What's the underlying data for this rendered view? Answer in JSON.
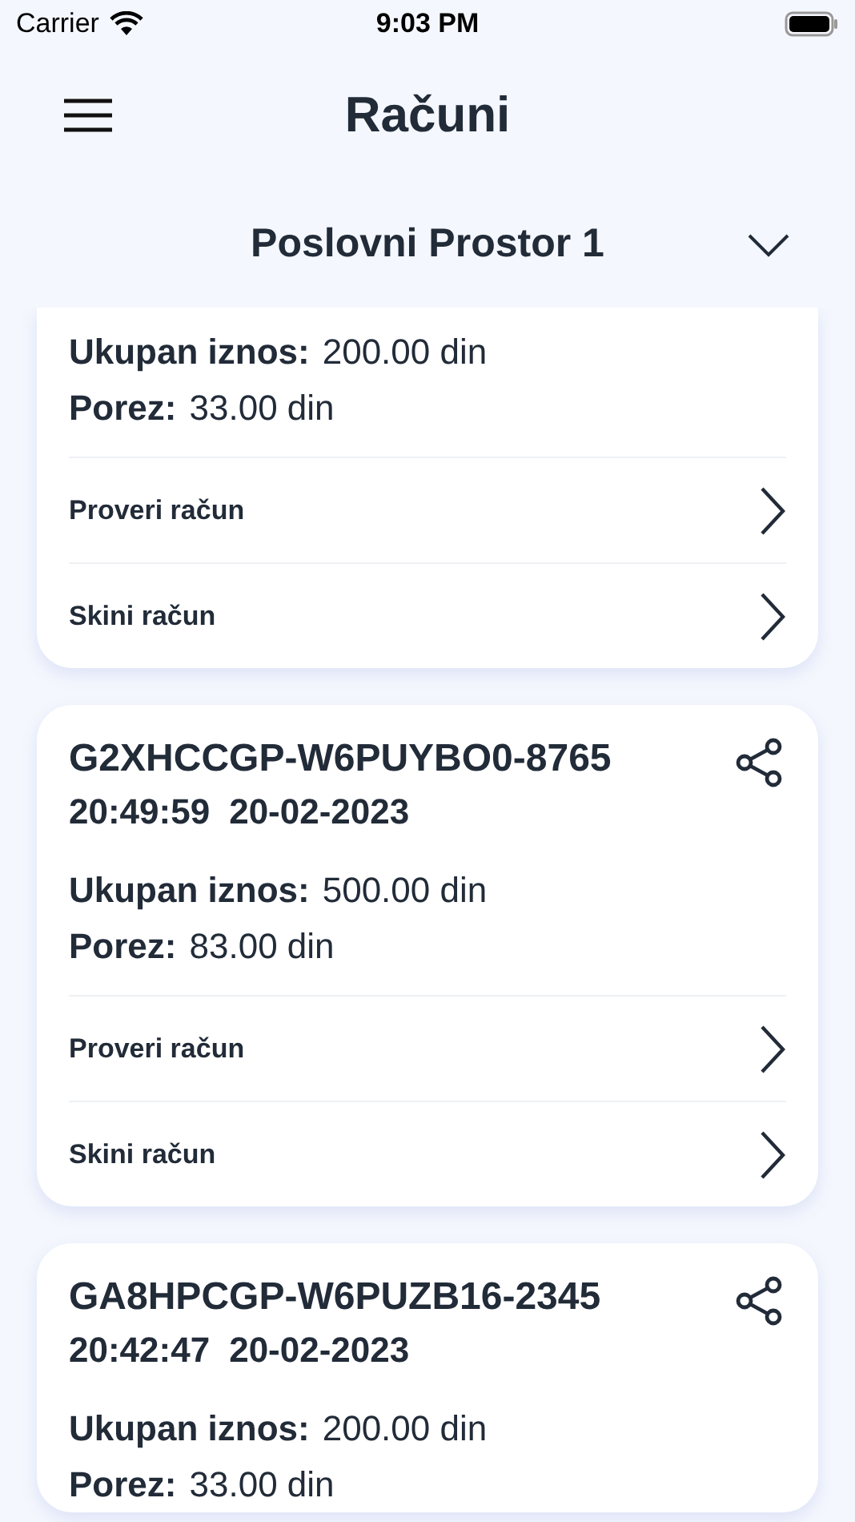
{
  "status_bar": {
    "carrier": "Carrier",
    "time": "9:03 PM"
  },
  "header": {
    "title": "Računi"
  },
  "location_selector": {
    "value": "Poslovni Prostor 1"
  },
  "receipts": [
    {
      "total_label": "Ukupan iznos:",
      "total": "200.00 din",
      "tax_label": "Porez:",
      "tax": "33.00 din",
      "actions": [
        "Proveri račun",
        "Skini račun"
      ]
    },
    {
      "id": "G2XHCCGP-W6PUYBO0-8765",
      "time": "20:49:59",
      "date": "20-02-2023",
      "total_label": "Ukupan iznos:",
      "total": "500.00 din",
      "tax_label": "Porez:",
      "tax": "83.00 din",
      "actions": [
        "Proveri račun",
        "Skini račun"
      ]
    },
    {
      "id": "GA8HPCGP-W6PUZB16-2345",
      "time": "20:42:47",
      "date": "20-02-2023",
      "total_label": "Ukupan iznos:",
      "total": "200.00 din",
      "tax_label": "Porez:",
      "tax": "33.00 din"
    }
  ]
}
